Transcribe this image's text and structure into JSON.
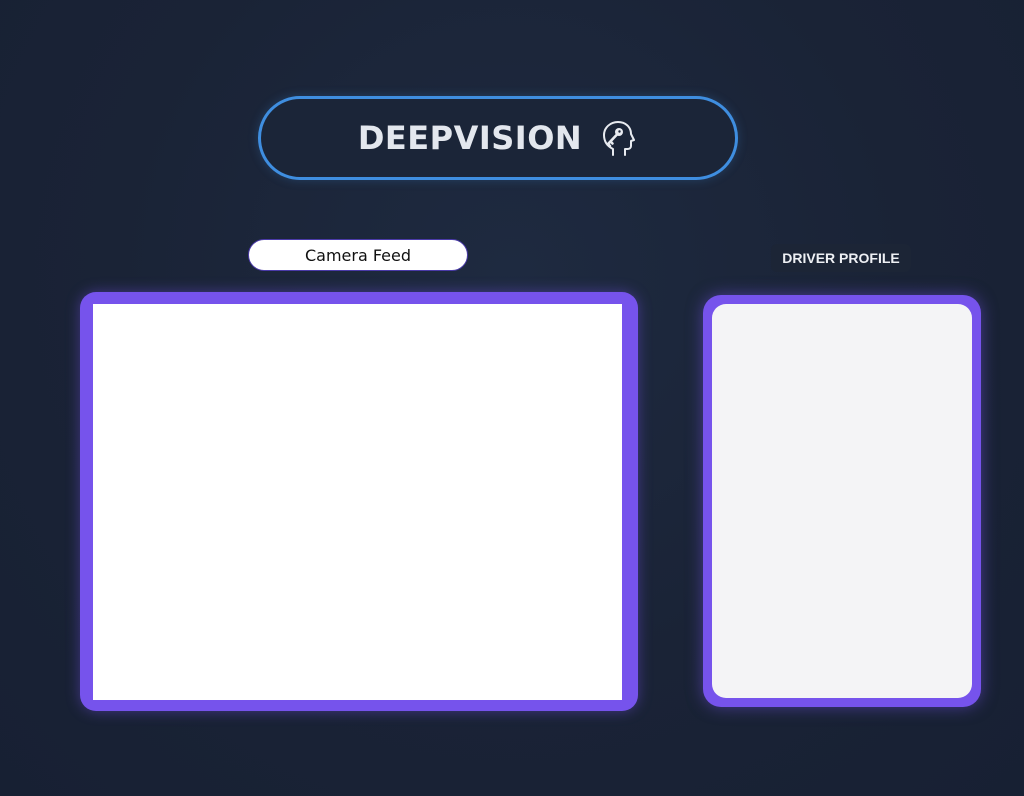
{
  "header": {
    "title": "DEEPVISION",
    "icon": "head-key-icon"
  },
  "camera": {
    "label": "Camera Feed"
  },
  "profile": {
    "label": "DRIVER PROFILE"
  },
  "colors": {
    "background": "#1a2336",
    "accent_blue": "#3f8ee0",
    "frame_purple": "#7653ec"
  }
}
